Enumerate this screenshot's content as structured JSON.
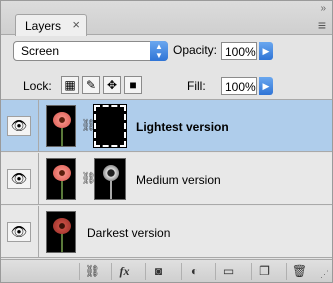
{
  "panel": {
    "tab_label": "Layers",
    "tab_close": "×",
    "collapse_glyph": "»",
    "menu_glyph": "≡"
  },
  "blending": {
    "mode": "Screen",
    "opacity_label": "Opacity:",
    "opacity_value": "100%",
    "fill_label": "Fill:",
    "fill_value": "100%"
  },
  "lock": {
    "label": "Lock:"
  },
  "layers": [
    {
      "name": "Lightest version",
      "selected": true,
      "has_mask": true
    },
    {
      "name": "Medium version",
      "selected": false,
      "has_mask": true
    },
    {
      "name": "Darkest version",
      "selected": false,
      "has_mask": false
    }
  ],
  "footer": {
    "icons": [
      "link-layers-icon",
      "fx-icon",
      "add-mask-icon",
      "adjustment-layer-icon",
      "new-group-icon",
      "new-layer-icon",
      "delete-layer-icon"
    ],
    "fx_label": "fx"
  },
  "colors": {
    "selection": "#afcdeb",
    "accent_blue": "#2f74d6"
  }
}
